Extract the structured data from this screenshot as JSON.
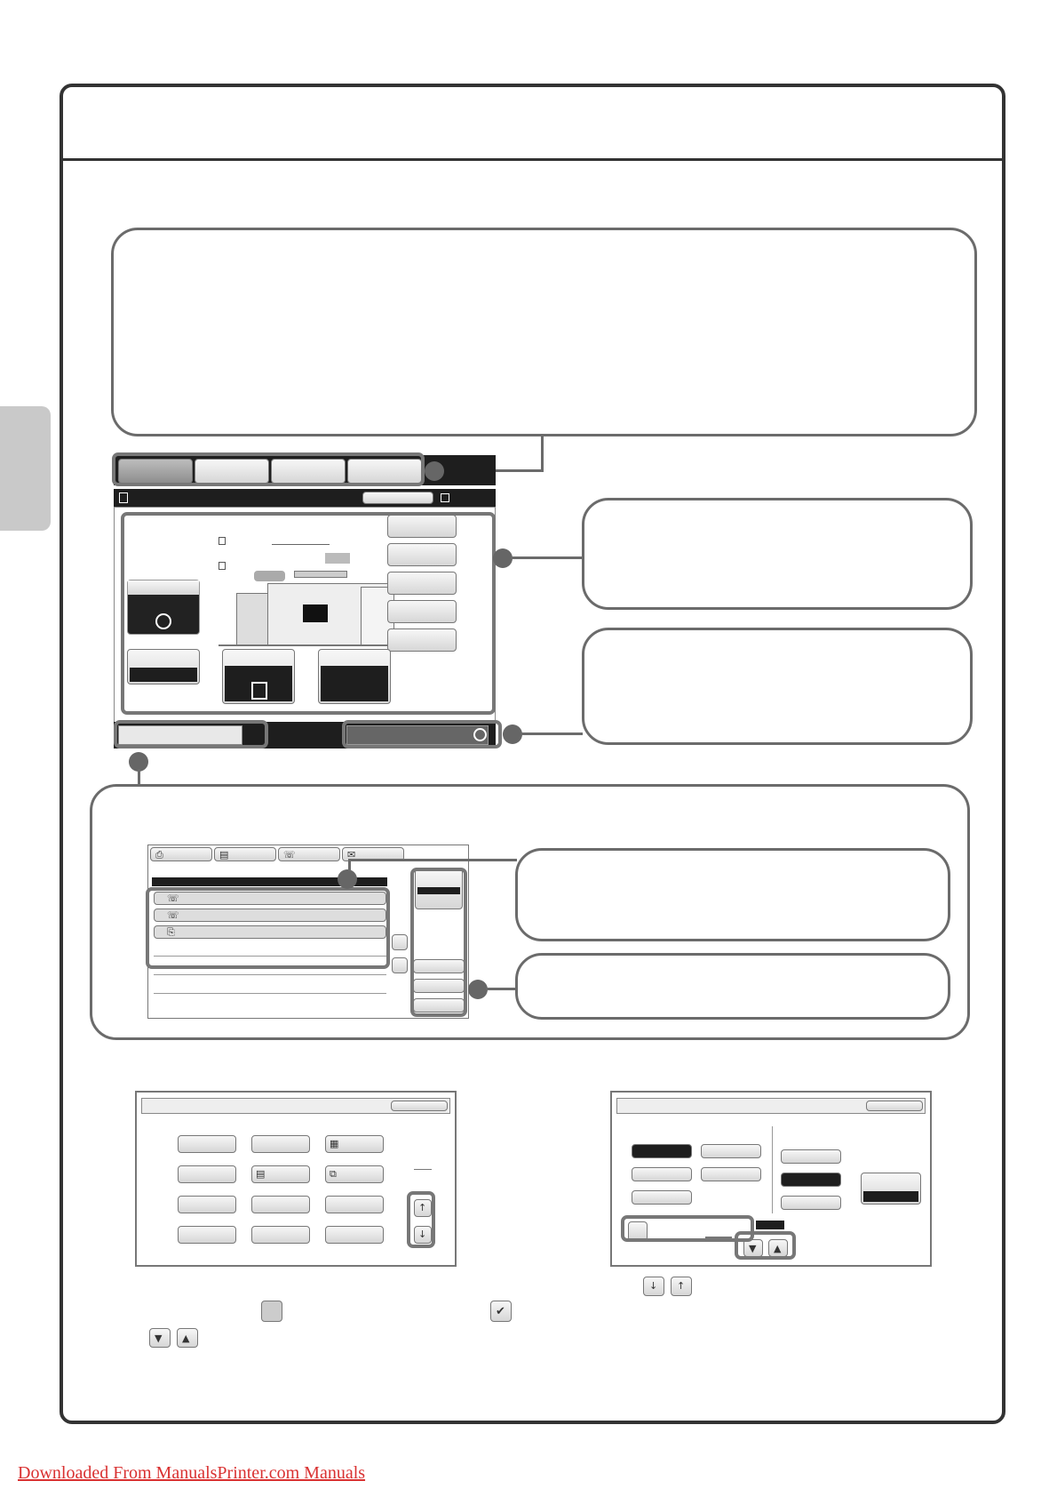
{
  "footer": {
    "download_link": "Downloaded From ManualsPrinter.com Manuals"
  },
  "icons": {
    "top_mode_tabs": [
      "mode-tab-1",
      "mode-tab-2",
      "mode-tab-3",
      "mode-tab-4"
    ],
    "job_status_tabs": [
      "print-job-icon",
      "scan-job-icon",
      "fax-job-icon",
      "internet-fax-job-icon"
    ],
    "job_rows": [
      "fax-icon",
      "fax-icon",
      "copy-icon"
    ],
    "checkbox_examples": [
      "unchecked-checkbox-icon",
      "checked-checkbox-icon"
    ],
    "arrow_examples": [
      "scroll-down-icon",
      "scroll-up-icon",
      "arrow-down-icon",
      "arrow-up-icon"
    ]
  },
  "colors": {
    "frame": "#333333",
    "callout_border": "#6b6b6b",
    "side_tab": "#c9c9c9",
    "selected_key": "#1e1e1e",
    "link": "#d93131"
  }
}
